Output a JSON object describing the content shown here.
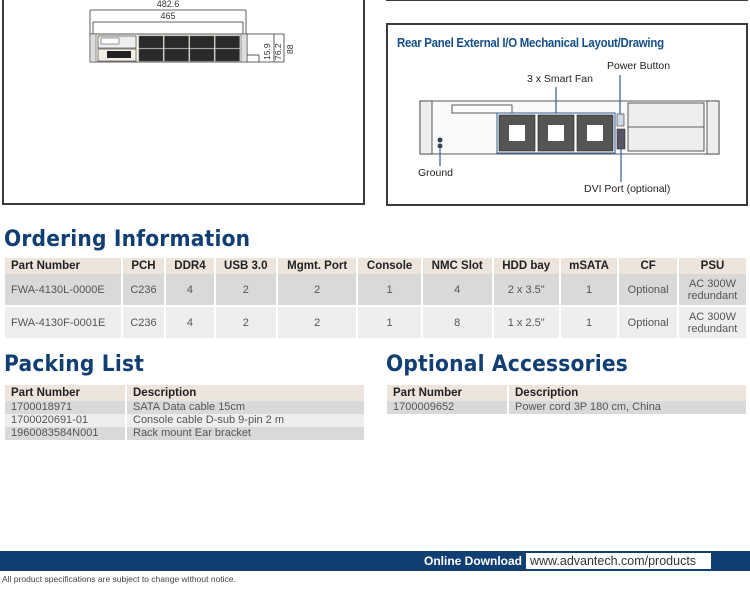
{
  "front_drawing": {
    "dimensions": {
      "overall_width": "482.6",
      "inner_width": "465",
      "height_small": "15.9",
      "height_mid": "76.2",
      "height_total": "88"
    }
  },
  "rear_panel": {
    "title": "Rear Panel External I/O Mechanical Layout/Drawing",
    "callouts": {
      "power_button": "Power Button",
      "smart_fan": "3 x Smart Fan",
      "ground": "Ground",
      "dvi_port": "DVI Port (optional)"
    }
  },
  "ordering": {
    "title": "Ordering Information",
    "columns": [
      "Part Number",
      "PCH",
      "DDR4",
      "USB 3.0",
      "Mgmt. Port",
      "Console",
      "NMC Slot",
      "HDD bay",
      "mSATA",
      "CF",
      "PSU"
    ],
    "rows": [
      [
        "FWA-4130L-0000E",
        "C236",
        "4",
        "2",
        "2",
        "1",
        "4",
        "2 x 3.5\"",
        "1",
        "Optional",
        "AC 300W redundant"
      ],
      [
        "FWA-4130F-0001E",
        "C236",
        "4",
        "2",
        "2",
        "1",
        "8",
        "1 x 2.5\"",
        "1",
        "Optional",
        "AC 300W redundant"
      ]
    ],
    "psu_lines": [
      "AC 300W",
      "redundant"
    ]
  },
  "packing": {
    "title": "Packing List",
    "columns": [
      "Part Number",
      "Description"
    ],
    "rows": [
      [
        "1700018971",
        "SATA Data cable 15cm"
      ],
      [
        "1700020691-01",
        "Console cable D-sub 9-pin 2 m"
      ],
      [
        "1960083584N001",
        "Rack mount Ear bracket"
      ]
    ]
  },
  "accessories": {
    "title": "Optional Accessories",
    "columns": [
      "Part Number",
      "Description"
    ],
    "rows": [
      [
        "1700009652",
        "Power cord 3P 180 cm, China"
      ]
    ]
  },
  "footer": {
    "download_label": "Online Download",
    "download_url": "www.advantech.com/products",
    "disclaimer": "All product specifications are subject to change without notice."
  },
  "colors": {
    "brand_blue": "#123f73",
    "title_blue": "#154f8a",
    "table_header": "#ede4dc",
    "row_dark": "#d9d9d9",
    "row_light": "#eeeeee"
  }
}
